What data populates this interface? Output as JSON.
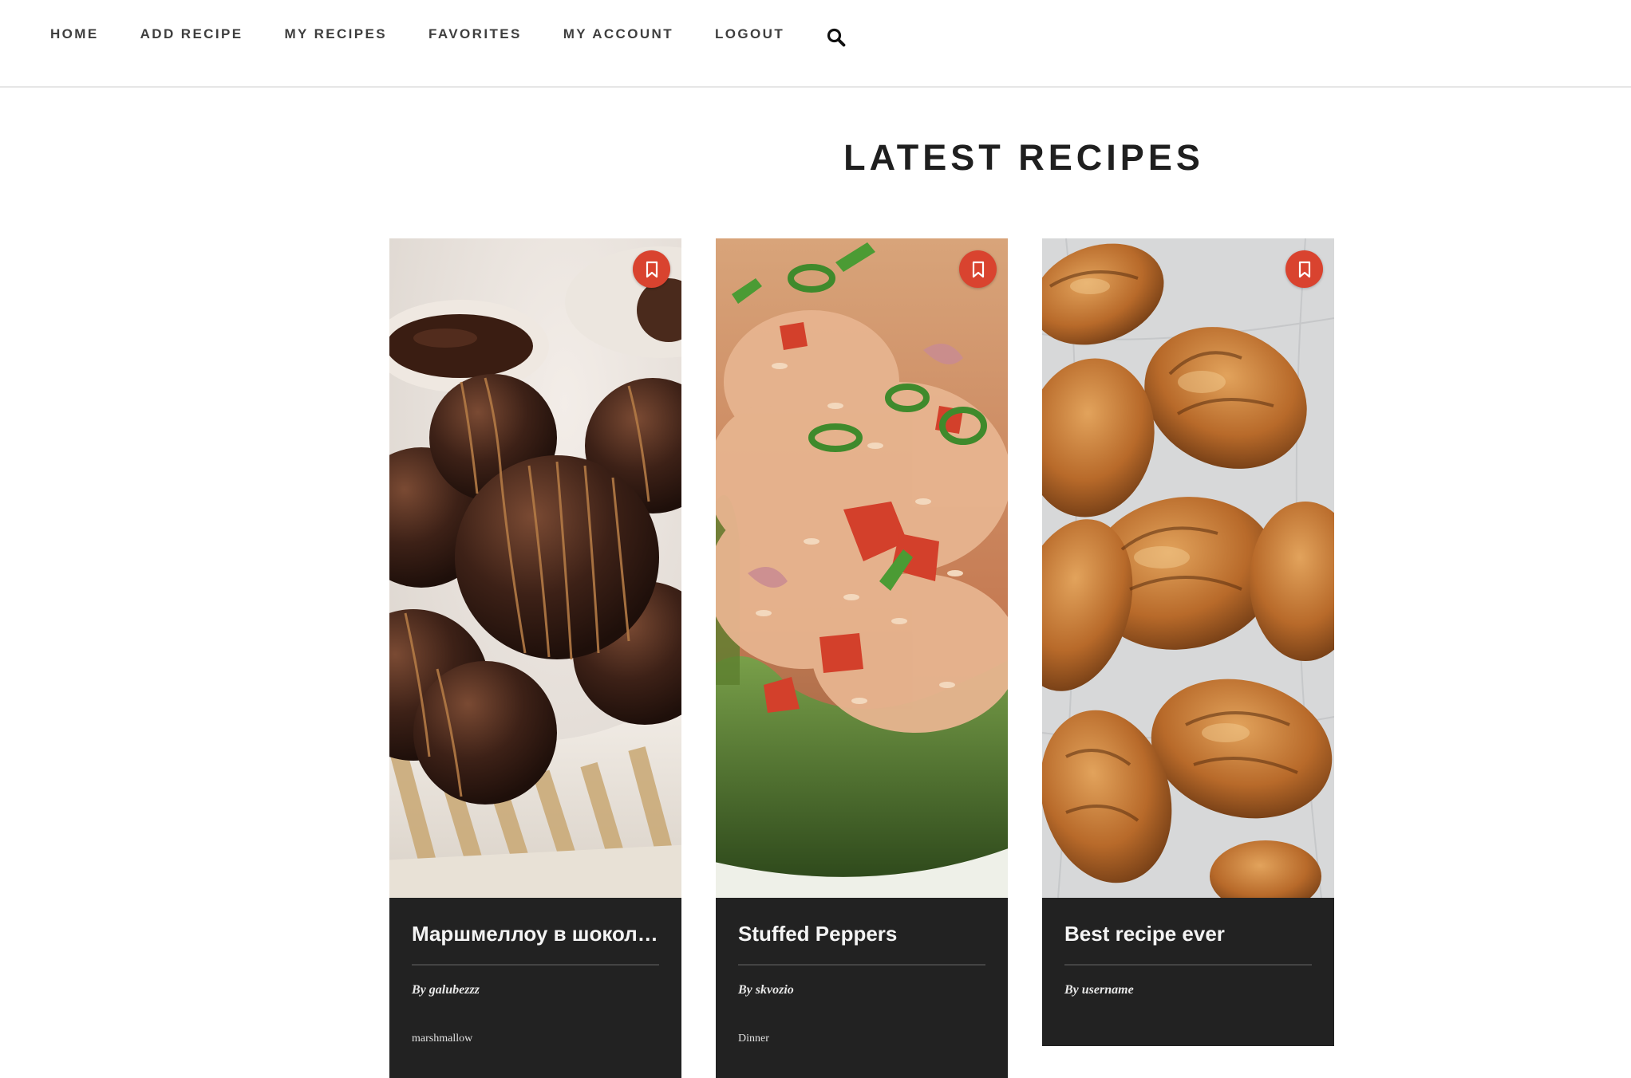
{
  "nav": {
    "items": [
      {
        "label": "HOME"
      },
      {
        "label": "ADD RECIPE"
      },
      {
        "label": "MY RECIPES"
      },
      {
        "label": "FAVORITES"
      },
      {
        "label": "MY ACCOUNT"
      },
      {
        "label": "LOGOUT"
      }
    ],
    "search_icon": "search-icon"
  },
  "main": {
    "title": "LATEST RECIPES",
    "recipes": [
      {
        "title": "Маршмеллоу в шокола...",
        "author": "By galubezzz",
        "tag": "marshmallow",
        "image": "chocolate-marshmallow-photo",
        "bookmark_icon": "bookmark-icon"
      },
      {
        "title": "Stuffed Peppers",
        "author": "By skvozio",
        "tag": "Dinner",
        "image": "stuffed-peppers-photo",
        "bookmark_icon": "bookmark-icon"
      },
      {
        "title": "Best recipe ever",
        "author": "By username",
        "tag": "",
        "image": "croissants-photo",
        "bookmark_icon": "bookmark-icon"
      }
    ]
  },
  "colors": {
    "accent": "#d9432f",
    "card_background": "#222222",
    "nav_text": "#3e3e3e",
    "heading_text": "#1f1f1f"
  }
}
